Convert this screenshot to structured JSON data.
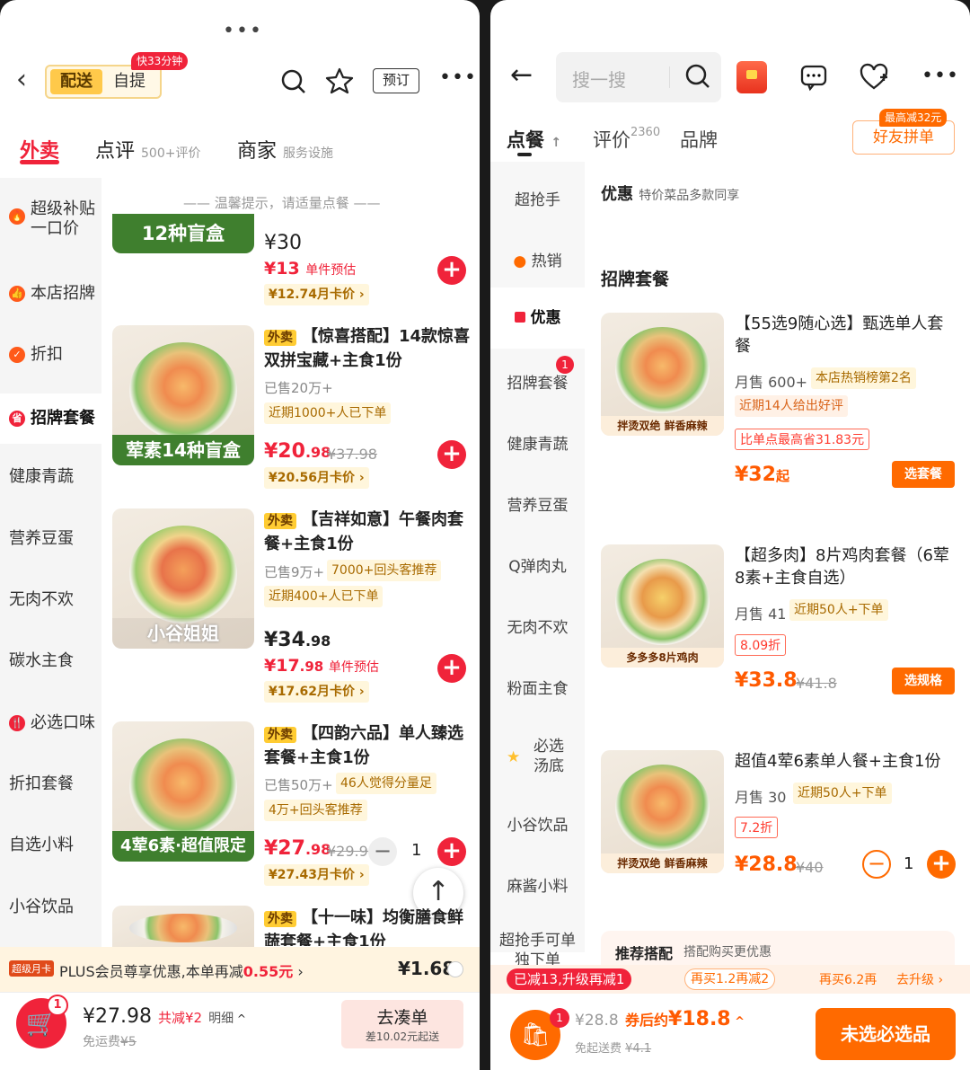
{
  "left": {
    "more_dots": "•••",
    "mode_tabs": [
      "配送",
      "自提"
    ],
    "mode_badge": "快33分钟",
    "reserve_btn": "预订",
    "tabs": [
      {
        "label": "外卖",
        "sub": ""
      },
      {
        "label": "点评",
        "sub": "500+评价"
      },
      {
        "label": "商家",
        "sub": "服务设施"
      }
    ],
    "tip": "—— 温馨提示，请适量点餐 ——",
    "sidebar": [
      "超级补贴一口价",
      "本店招牌",
      "折扣",
      "招牌套餐",
      "健康青蔬",
      "营养豆蛋",
      "无肉不欢",
      "碳水主食",
      "必选口味",
      "折扣套餐",
      "自选小料",
      "小谷饮品"
    ],
    "items": [
      {
        "img_label": "12种盲盒",
        "price": "¥30",
        "est_price": "¥13",
        "est_label": "单件预估",
        "card_price": "¥12.74月卡价 ›"
      },
      {
        "badge": "外卖",
        "title": "【惊喜搭配】14款惊喜双拼宝藏+主食1份",
        "sold": "已售20万+",
        "tag1": "近期1000+人已下单",
        "price_main": "¥20",
        "price_dec": ".98",
        "orig": "¥37.98",
        "card_price": "¥20.56月卡价 ›",
        "img_label": "荤素14种盲盒"
      },
      {
        "badge": "外卖",
        "title": "【吉祥如意】午餐肉套餐+主食1份",
        "sold": "已售9万+",
        "tag1": "7000+回头客推荐",
        "tag2": "近期400+人已下单",
        "price_main": "¥34",
        "price_dec": ".98",
        "est_main": "¥17",
        "est_dec": ".98",
        "est_label": "单件预估",
        "card_price": "¥17.62月卡价 ›",
        "img_label": "小谷姐姐"
      },
      {
        "badge": "外卖",
        "title": "【四韵六品】单人臻选套餐+主食1份",
        "sold": "已售50万+",
        "tag1": "46人觉得分量足",
        "tag2": "4万+回头客推荐",
        "price_main": "¥27",
        "price_dec": ".98",
        "orig": "¥29.98",
        "card_price": "¥27.43月卡价 ›",
        "qty": "1",
        "img_label": "4荤6素·超值限定"
      },
      {
        "badge": "外卖",
        "title": "【十一味】均衡膳食鲜蔬套餐+主食1份"
      }
    ],
    "plus_bar": {
      "tag": "超级月卡",
      "text": "PLUS会员尊享优惠,本单再减",
      "amount": "0.55元",
      "arrow": "›",
      "price": "¥1.68"
    },
    "cart": {
      "count": "1",
      "total": "¥27.98",
      "discount": "共减¥2",
      "detail": "明细",
      "delivery": "免运费",
      "delivery_orig": "¥5",
      "btn": "去凑单",
      "btn_sub": "差10.02元起送"
    }
  },
  "right": {
    "search_placeholder": "搜一搜",
    "tabs": [
      {
        "label": "点餐",
        "sub": ""
      },
      {
        "label": "评价",
        "sub": "2360"
      },
      {
        "label": "品牌",
        "sub": ""
      }
    ],
    "group_btn": "好友拼单",
    "group_badge": "最高减32元",
    "sidebar": [
      "超抢手",
      "热销",
      "优惠",
      "招牌套餐",
      "健康青蔬",
      "营养豆蛋",
      "Q弹肉丸",
      "无肉不欢",
      "粉面主食",
      "必选汤底",
      "小谷饮品",
      "麻酱小料",
      "超抢手可单独下单"
    ],
    "sidebar_badge": "1",
    "promo_title": "优惠",
    "promo_sub": "特价菜品多款同享",
    "section_title": "招牌套餐",
    "items": [
      {
        "title": "【55选9随心选】甄选单人套餐",
        "sold": "月售 600+",
        "rank": "本店热销榜第2名",
        "tag1": "近期14人给出好评",
        "tag2": "比单点最高省31.83元",
        "price": "¥32",
        "suffix": "起",
        "btn": "选套餐",
        "img_label": "拌烫双绝 鲜香麻辣"
      },
      {
        "title": "【超多肉】8片鸡肉套餐（6荤8素+主食自选）",
        "sold": "月售 41",
        "tag1": "近期50人+下单",
        "discount": "8.09折",
        "price": "¥33.8",
        "orig": "¥41.8",
        "btn": "选规格",
        "img_label": "多多多8片鸡肉"
      },
      {
        "title": "超值4荤6素单人餐+主食1份",
        "sold": "月售 30",
        "tag1": "近期50人+下单",
        "discount": "7.2折",
        "price": "¥28.8",
        "orig": "¥40",
        "qty": "1",
        "img_label": "拌烫双绝 鲜香麻辣"
      }
    ],
    "recommend": {
      "title": "推荐搭配",
      "sub": "搭配购买更优惠"
    },
    "promo_bar": {
      "done": "已减13,升级再减1",
      "step2": "再买1.2再减2",
      "step3": "再买6.2再",
      "upgrade": "去升级 ›"
    },
    "cart": {
      "count": "1",
      "total": "¥28.8",
      "after_label": "券后约",
      "after_price": "¥18.8",
      "delivery": "免起送费",
      "delivery_orig": "¥4.1",
      "btn": "未选必选品"
    }
  },
  "colors": {
    "red": "#f0233a",
    "orange": "#ff6a00",
    "brand_green": "#3f7f2e"
  }
}
